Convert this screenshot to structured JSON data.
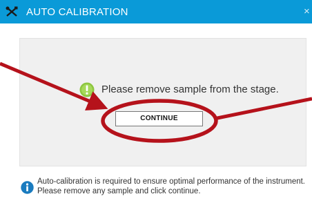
{
  "window": {
    "title": "AUTO CALIBRATION",
    "title_icon": "tools-icon",
    "close_label": "×"
  },
  "panel": {
    "message": "Please remove sample from the stage.",
    "message_icon": "alert-icon",
    "continue_label": "CONTINUE"
  },
  "info": {
    "icon": "info-icon",
    "line1": "Auto-calibration is required to ensure optimal performance of the instrument.",
    "line2": "Please remove any sample and click continue."
  },
  "colors": {
    "titlebar": "#0a9ad8",
    "alert": "#8dc63f",
    "info": "#1a7bbf",
    "annotation": "#b5121b"
  }
}
